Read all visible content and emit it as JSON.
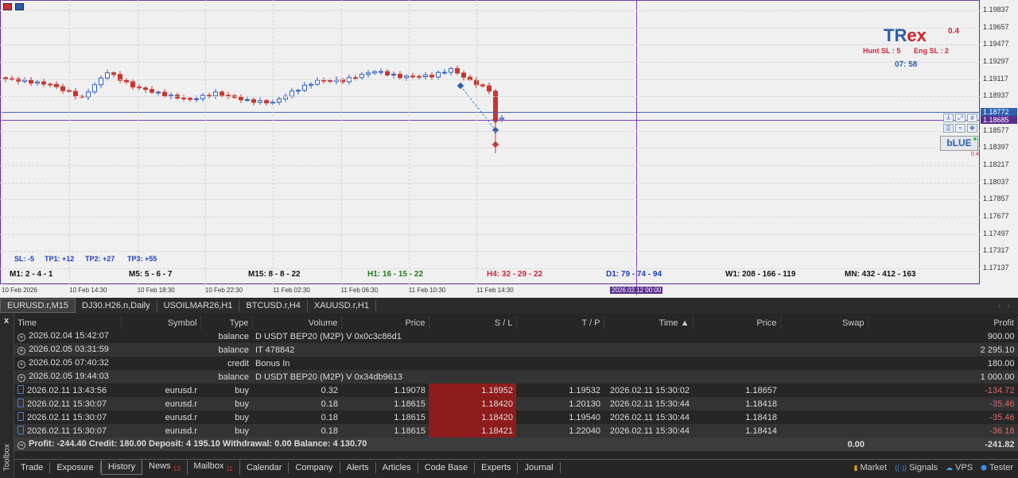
{
  "chart": {
    "price_ticks": [
      "1.19837",
      "1.19657",
      "1.19477",
      "1.19297",
      "1.19117",
      "1.18937",
      "1.18577",
      "1.18397",
      "1.18217",
      "1.18037",
      "1.17857",
      "1.17677",
      "1.17497",
      "1.17317",
      "1.17137"
    ],
    "time_ticks": [
      "10 Feb 2026",
      "10 Feb 14:30",
      "10 Feb 18:30",
      "10 Feb 22:30",
      "11 Feb 02:30",
      "11 Feb 06:30",
      "11 Feb 10:30",
      "11 Feb 14:30"
    ],
    "crosshair_time": "2026.02.12 00:00",
    "bid_tag": "1.18772",
    "cross_tag": "1.18685",
    "trex": {
      "t1": "TR",
      "t2": "ex",
      "value": "0.4",
      "hunt": "Hunt SL : 5",
      "eng": "Eng SL : 2",
      "timer": "07: 58"
    },
    "blue_button": "bLUE",
    "blue_value": "0.4",
    "levels": {
      "sl": "SL: -5",
      "tp1": "TP1: +12",
      "tp2": "TP2: +27",
      "tp3": "TP3: +55"
    },
    "timeframes": [
      "M1: 2 - 4 - 1",
      "M5: 5 - 6 - 7",
      "M15: 8 - 8 - 22",
      "H1: 16 - 15 - 22",
      "H4: 32 - 29 - 22",
      "D1: 79 - 74 - 94",
      "W1: 208 - 166 - 119",
      "MN: 432 - 412 - 163"
    ],
    "colors": {
      "up": "#2e5fc9",
      "down": "#c8362f",
      "h1": "#1e7a1e",
      "h4": "#d0243a",
      "d1": "#1f3fbf"
    },
    "keypoints": [
      [
        0,
        1.1913
      ],
      [
        7,
        1.1907
      ],
      [
        12,
        1.1893
      ],
      [
        16,
        1.192
      ],
      [
        20,
        1.1905
      ],
      [
        25,
        1.1896
      ],
      [
        29,
        1.1891
      ],
      [
        33,
        1.1898
      ],
      [
        38,
        1.189
      ],
      [
        42,
        1.1888
      ],
      [
        45,
        1.1899
      ],
      [
        49,
        1.1911
      ],
      [
        53,
        1.1911
      ],
      [
        58,
        1.1921
      ],
      [
        62,
        1.1915
      ],
      [
        67,
        1.1916
      ],
      [
        70,
        1.1923
      ],
      [
        73,
        1.1911
      ],
      [
        76,
        1.1901
      ],
      [
        77,
        1.187
      ],
      [
        78,
        1.1872
      ]
    ]
  },
  "symbol_tabs": [
    "EURUSD.r,M15",
    "DJ30.H26.n,Daily",
    "USOILMAR26,H1",
    "BTCUSD.r,H4",
    "XAUUSD.r,H1"
  ],
  "toolbox": {
    "close": "x",
    "label": "Toolbox",
    "headers": [
      "Time",
      "Symbol",
      "Type",
      "Volume",
      "Price",
      "S / L",
      "T / P",
      "Time ▲",
      "Price",
      "Swap",
      "Profit"
    ],
    "rows": [
      {
        "time": "2026.02.04 15:42:07",
        "type": "balance",
        "comment": "D USDT BEP20 (M2P) V 0x0c3c86d1",
        "profit": "900.00"
      },
      {
        "time": "2026.02.05 03:31:59",
        "type": "balance",
        "comment": "IT 478842",
        "profit": "2 295.10"
      },
      {
        "time": "2026.02.05 07:40:32",
        "type": "credit",
        "comment": "Bonus In",
        "profit": "180.00"
      },
      {
        "time": "2026.02.05 19:44:03",
        "type": "balance",
        "comment": "D USDT BEP20 (M2P) V 0x34db9613",
        "profit": "1 000.00"
      }
    ],
    "trades": [
      {
        "time": "2026.02.11 13:43:56",
        "symbol": "eurusd.r",
        "type": "buy",
        "volume": "0.32",
        "price": "1.19078",
        "sl": "1.18952",
        "tp": "1.19532",
        "ctime": "2026.02.11 15:30:02",
        "cprice": "1.18657",
        "profit": "-134.72"
      },
      {
        "time": "2026.02.11 15:30:07",
        "symbol": "eurusd.r",
        "type": "buy",
        "volume": "0.18",
        "price": "1.18615",
        "sl": "1.18420",
        "tp": "1.20130",
        "ctime": "2026.02.11 15:30:44",
        "cprice": "1.18418",
        "profit": "-35.46"
      },
      {
        "time": "2026.02.11 15:30:07",
        "symbol": "eurusd.r",
        "type": "buy",
        "volume": "0.18",
        "price": "1.18615",
        "sl": "1.18420",
        "tp": "1.19540",
        "ctime": "2026.02.11 15:30:44",
        "cprice": "1.18418",
        "profit": "-35.46"
      },
      {
        "time": "2026.02.11 15:30:07",
        "symbol": "eurusd.r",
        "type": "buy",
        "volume": "0.18",
        "price": "1.18615",
        "sl": "1.18421",
        "tp": "1.22040",
        "ctime": "2026.02.11 15:30:44",
        "cprice": "1.18414",
        "profit": "-36.18"
      }
    ],
    "summary": {
      "text": "Profit: -244.40  Credit: 180.00  Deposit: 4 195.10  Withdrawal: 0.00  Balance: 4 130.70",
      "swap": "0.00",
      "profit": "-241.82"
    },
    "tabs": [
      "Trade",
      "Exposure",
      "History",
      "News",
      "Mailbox",
      "Calendar",
      "Company",
      "Alerts",
      "Articles",
      "Code Base",
      "Experts",
      "Journal"
    ],
    "news_count": "13",
    "mail_count": "11",
    "right": [
      "Market",
      "Signals",
      "VPS",
      "Tester"
    ]
  }
}
